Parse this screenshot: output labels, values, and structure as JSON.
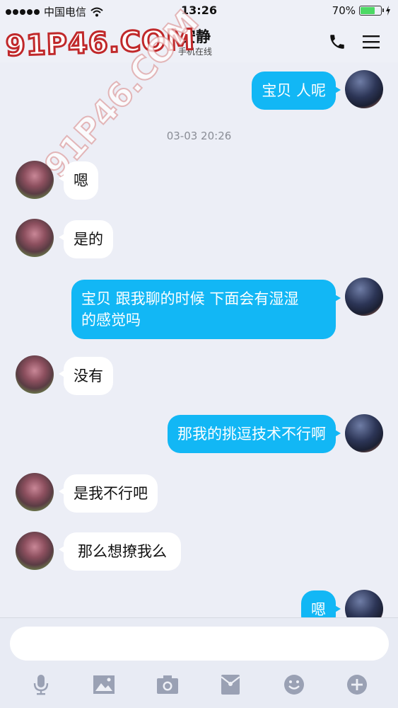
{
  "status": {
    "carrier": "中国电信",
    "time": "13:26",
    "battery": "70%",
    "battery_level": 0.7
  },
  "header": {
    "contact_name": "安静",
    "contact_status": "手机在线",
    "watermark": "91P46.COM"
  },
  "chat": {
    "messages": [
      {
        "from": "me",
        "text": "宝贝 人呢"
      },
      {
        "from": "her",
        "text": "嗯"
      },
      {
        "from": "her",
        "text": "是的"
      },
      {
        "from": "me",
        "text_line1": "宝贝 跟我聊的时候 下面会有湿湿",
        "text_line2": "的感觉吗"
      },
      {
        "from": "her",
        "text": "没有"
      },
      {
        "from": "me",
        "text": "那我的挑逗技术不行啊"
      },
      {
        "from": "her",
        "text": "是我不行吧"
      },
      {
        "from": "her",
        "text": "那么想撩我么"
      },
      {
        "from": "me",
        "text": "嗯"
      }
    ],
    "timestamp": "03-03 20:26"
  },
  "composer": {
    "placeholder": "",
    "tools": [
      "microphone-icon",
      "image-icon",
      "camera-icon",
      "red-packet-icon",
      "emoji-icon",
      "plus-icon"
    ]
  },
  "colors": {
    "my_bubble": "#12b7f5",
    "her_bubble": "#ffffff",
    "background": "#eceef6"
  }
}
